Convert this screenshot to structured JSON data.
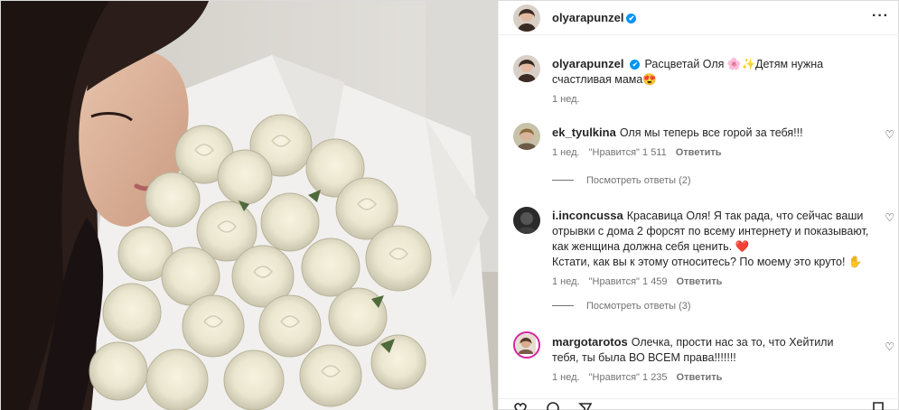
{
  "post": {
    "author": "olyarapunzel",
    "verified_mark": "✔",
    "more_icon": "more-horizontal-icon"
  },
  "caption": {
    "author": "olyarapunzel",
    "text": "Расцветай Оля 🌸✨Детям нужна счастливая мама😍",
    "time": "1 нед."
  },
  "comments": [
    {
      "author": "ek_tyulkina",
      "text": "Оля мы теперь все горой за тебя!!!",
      "time": "1 нед.",
      "likes": "\"Нравится\" 1 511",
      "reply": "Ответить",
      "view_replies": "Посмотреть ответы (2)"
    },
    {
      "author": "i.inconcussa",
      "text": "Красавица Оля! Я так рада, что сейчас ваши отрывки с дома 2 форсят по всему интернету и показывают, как женщина должна себя ценить. ❤️",
      "text2": "Кстати, как вы к этому относитесь? По моему это круто! ✋",
      "time": "1 нед.",
      "likes": "\"Нравится\" 1 459",
      "reply": "Ответить",
      "view_replies": "Посмотреть ответы (3)"
    },
    {
      "author": "margotarotos",
      "text": "Олечка, прости нас за то, что Хейтили тебя, ты была ВО ВСЕМ права!!!!!!!",
      "time": "1 нед.",
      "likes": "\"Нравится\" 1 235",
      "reply": "Ответить"
    }
  ],
  "icons": {
    "heart": "♡",
    "like_action": "heart-icon",
    "comment_action": "comment-icon",
    "share_action": "share-icon",
    "save_action": "bookmark-icon"
  },
  "colors": {
    "verified": "#0095f6",
    "meta_text": "#737373",
    "story_ring": "#d6249f"
  }
}
